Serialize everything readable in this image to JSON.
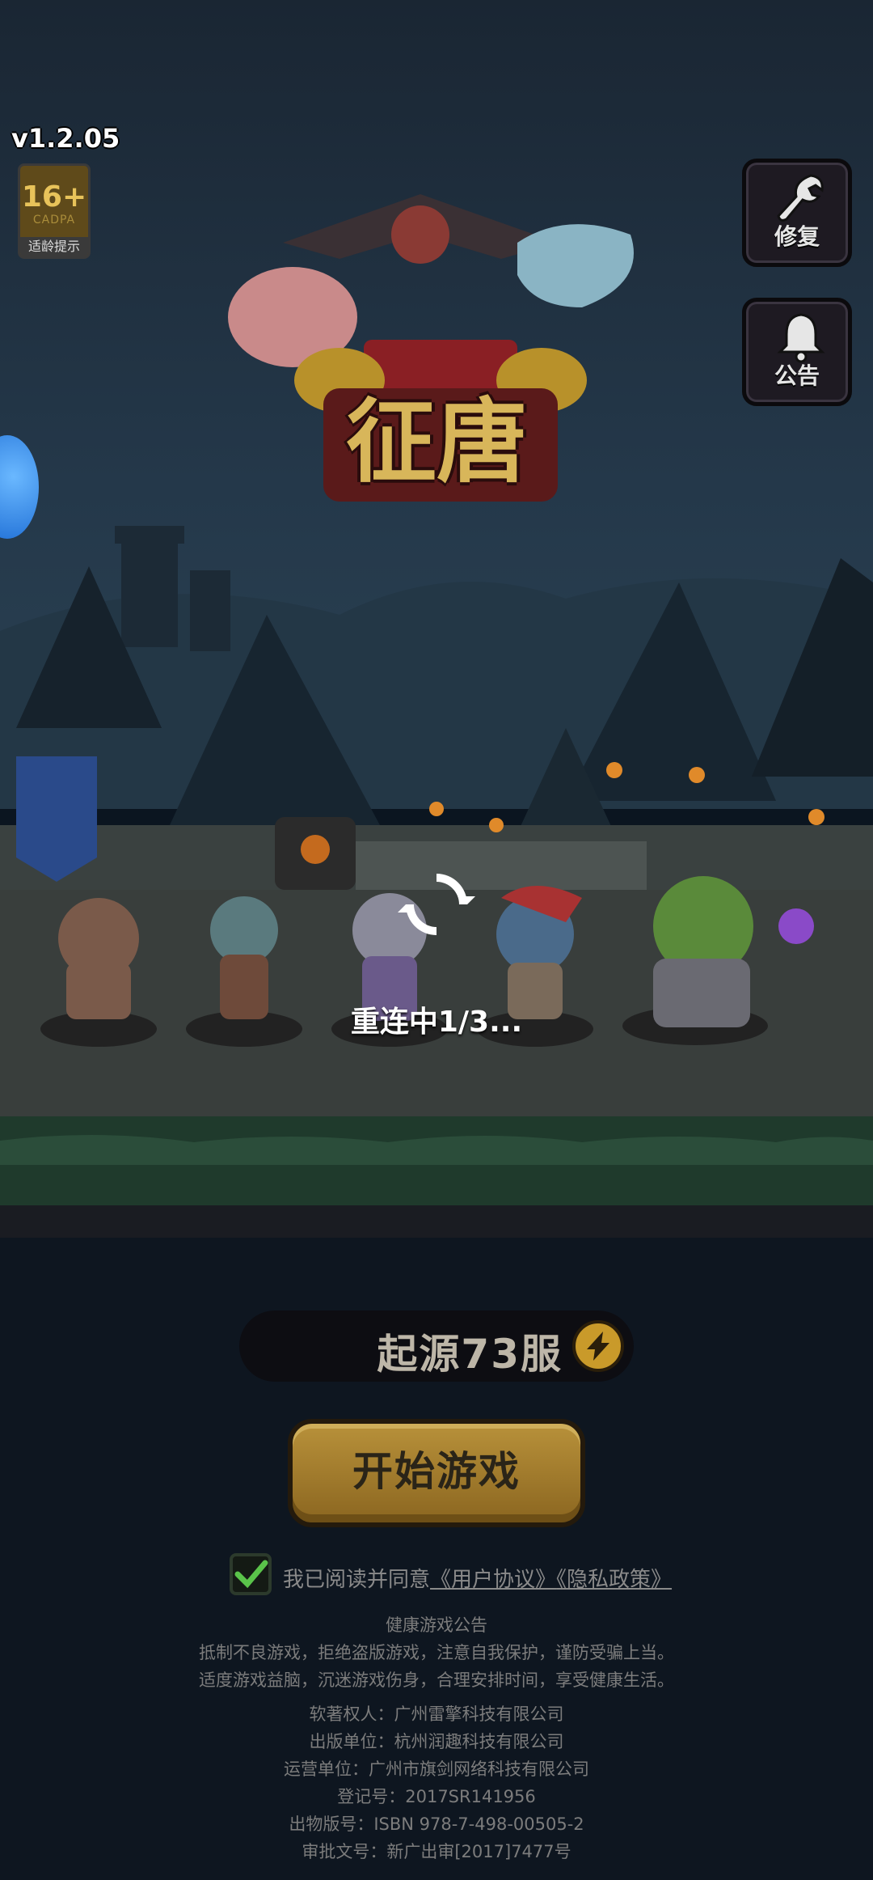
{
  "app": {
    "version": "v1.2.05",
    "game_title": "征唐"
  },
  "age_rating": {
    "age": "16+",
    "org": "CADPA",
    "tip": "适龄提示"
  },
  "side_buttons": {
    "repair_label": "修复",
    "notice_label": "公告"
  },
  "status": {
    "reconnect_text": "重连中1/3..."
  },
  "server": {
    "name": "起源73服"
  },
  "actions": {
    "start_label": "开始游戏"
  },
  "agreement": {
    "checked": true,
    "prefix": "我已阅读并同意",
    "user_agreement": "《用户协议》",
    "privacy_policy": "《隐私政策》"
  },
  "health_notice": {
    "title": "健康游戏公告",
    "line1": "抵制不良游戏，拒绝盗版游戏，注意自我保护，谨防受骗上当。",
    "line2": "适度游戏益脑，沉迷游戏伤身，合理安排时间，享受健康生活。"
  },
  "legal": {
    "copyright": "软著权人：广州雷擎科技有限公司",
    "publisher": "出版单位：杭州润趣科技有限公司",
    "operator": "运营单位：广州市旗剑网络科技有限公司",
    "registration": "登记号：2017SR141956",
    "isbn": "出物版号：ISBN 978-7-498-00505-2",
    "approval": "审批文号：新广出审[2017]7477号"
  },
  "colors": {
    "sky_top": "#1b2b3b",
    "ground_green": "#1c3a2c",
    "gold": "#b8913a",
    "check_green": "#5ac34a"
  }
}
